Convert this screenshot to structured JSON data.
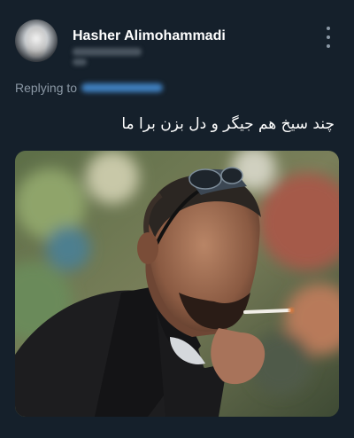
{
  "tweet": {
    "author_name": "Hasher Alimohammadi",
    "replying_to_label": "Replying to",
    "text": "چند سیخ هم جیگر و دل بزن برا ما"
  },
  "icons": {
    "more": "more-vertical-icon",
    "avatar": "profile-avatar"
  },
  "colors": {
    "background": "#15202b",
    "primary_text": "#ffffff",
    "secondary_text": "#8b98a5",
    "link": "#1d9bf0"
  }
}
